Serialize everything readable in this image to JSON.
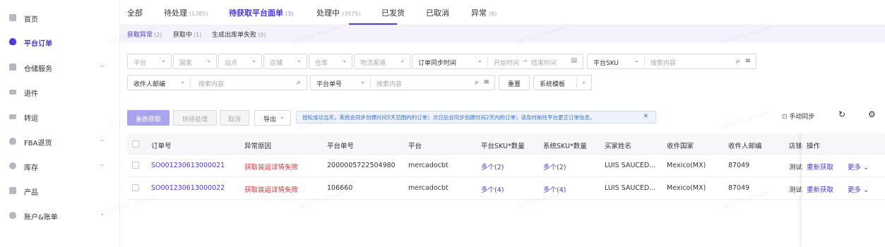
{
  "sidebar": {
    "items": [
      {
        "label": "首页",
        "chevron": ""
      },
      {
        "label": "平台订单",
        "chevron": ""
      },
      {
        "label": "仓储服务",
        "chevron": "⌄"
      },
      {
        "label": "退件",
        "chevron": ""
      },
      {
        "label": "转运",
        "chevron": ""
      },
      {
        "label": "FBA退货",
        "chevron": "⌄"
      },
      {
        "label": "库存",
        "chevron": "⌄"
      },
      {
        "label": "产品",
        "chevron": ""
      },
      {
        "label": "账户&账单",
        "chevron": "⌄"
      }
    ]
  },
  "tabs": [
    {
      "label": "全部",
      "count": ""
    },
    {
      "label": "待处理",
      "count": "(1385)"
    },
    {
      "label": "待获取平台面单",
      "count": "(3)"
    },
    {
      "label": "处理中",
      "count": "(3575)"
    },
    {
      "label": "已发货",
      "count": ""
    },
    {
      "label": "已取消",
      "count": ""
    },
    {
      "label": "异常",
      "count": "(6)"
    }
  ],
  "subtabs": [
    {
      "label": "获取异常",
      "count": "(2)"
    },
    {
      "label": "获取中",
      "count": "(1)"
    },
    {
      "label": "生成出库单失败",
      "count": "(0)"
    }
  ],
  "filters": {
    "platform": "平台",
    "country": "国家",
    "site": "站点",
    "store": "店铺",
    "warehouse": "仓库",
    "channel": "物流渠道",
    "time_type": "订单同步时间",
    "start_time": "开始时间",
    "arrow": "→",
    "end_time": "结束时间",
    "sku_type": "平台SKU",
    "search_placeholder": "搜索内容",
    "zip_type": "收件人邮编",
    "zip_placeholder": "搜索内容",
    "order_type": "平台单号",
    "order_placeholder": "搜索内容",
    "reset": "重置",
    "template": "系统模板"
  },
  "toolbar": {
    "refetch": "重新获取",
    "to_pending": "转待处理",
    "cancel": "取消",
    "export": "导出",
    "notice": "授权成功当天，系统会同步创建时间5天范围内的订单；次日后会同步创建时间2天内的订单；请及时前往平台更正订单信息。",
    "manual_sync": "手动同步"
  },
  "table": {
    "headers": [
      "订单号",
      "异常原因",
      "平台单号",
      "平台",
      "平台SKU*数量",
      "系统SKU*数量",
      "买家姓名",
      "收件国家",
      "收件人邮编",
      "店铺",
      "操作"
    ],
    "rows": [
      {
        "order_no": "SO001230613000021",
        "reason": "获取装运详情失败",
        "platform_no": "2000005722504980",
        "platform": "mercadocbt",
        "platform_sku": "多个(2)",
        "system_sku": "多个(2)",
        "buyer": "LUIS SAUCED...",
        "country": "Mexico(MX)",
        "zip": "87049",
        "store": "测试",
        "op1": "重新获取",
        "op2": "更多"
      },
      {
        "order_no": "SO001230613000022",
        "reason": "获取装运详情失败",
        "platform_no": "106660",
        "platform": "mercadocbt",
        "platform_sku": "多个(4)",
        "system_sku": "多个(4)",
        "buyer": "LUIS SAUCED...",
        "country": "Mexico(MX)",
        "zip": "87049",
        "store": "测试",
        "op1": "重新获取",
        "op2": "更多"
      }
    ]
  },
  "watermark": "1071001 zhangfei",
  "colors": {
    "accent": "#4b3bd8",
    "error": "#e2343b",
    "notice": "#3a6fe0"
  }
}
